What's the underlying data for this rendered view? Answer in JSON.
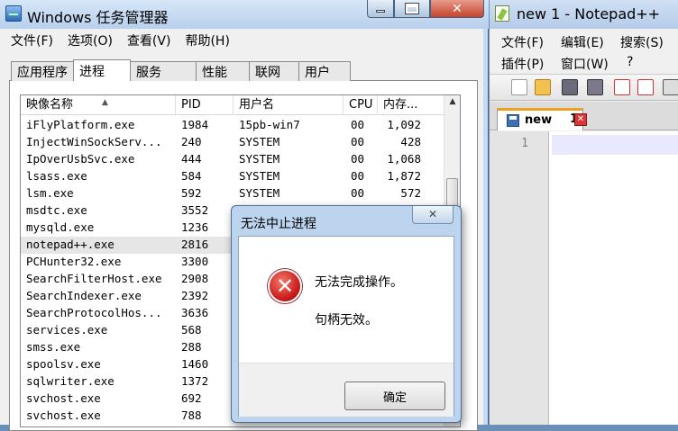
{
  "task_manager": {
    "title": "Windows 任务管理器",
    "menu": [
      "文件(F)",
      "选项(O)",
      "查看(V)",
      "帮助(H)"
    ],
    "tabs": [
      "应用程序",
      "进程",
      "服务",
      "性能",
      "联网",
      "用户"
    ],
    "active_tab": "进程",
    "columns": [
      "映像名称",
      "PID",
      "用户名",
      "CPU",
      "内存..."
    ],
    "processes": [
      {
        "name": "iFlyPlatform.exe",
        "pid": "1984",
        "user": "15pb-win7",
        "cpu": "00",
        "mem": "1,092"
      },
      {
        "name": "InjectWinSockServ...",
        "pid": "240",
        "user": "SYSTEM",
        "cpu": "00",
        "mem": "428"
      },
      {
        "name": "IpOverUsbSvc.exe",
        "pid": "444",
        "user": "SYSTEM",
        "cpu": "00",
        "mem": "1,068"
      },
      {
        "name": "lsass.exe",
        "pid": "584",
        "user": "SYSTEM",
        "cpu": "00",
        "mem": "1,872"
      },
      {
        "name": "lsm.exe",
        "pid": "592",
        "user": "SYSTEM",
        "cpu": "00",
        "mem": "572"
      },
      {
        "name": "msdtc.exe",
        "pid": "3552",
        "user": "",
        "cpu": "",
        "mem": ""
      },
      {
        "name": "mysqld.exe",
        "pid": "1236",
        "user": "",
        "cpu": "",
        "mem": ""
      },
      {
        "name": "notepad++.exe",
        "pid": "2816",
        "user": "",
        "cpu": "",
        "mem": "",
        "selected": true
      },
      {
        "name": "PCHunter32.exe",
        "pid": "3300",
        "user": "",
        "cpu": "",
        "mem": ""
      },
      {
        "name": "SearchFilterHost.exe",
        "pid": "2908",
        "user": "",
        "cpu": "",
        "mem": ""
      },
      {
        "name": "SearchIndexer.exe",
        "pid": "2392",
        "user": "",
        "cpu": "",
        "mem": ""
      },
      {
        "name": "SearchProtocolHos...",
        "pid": "3636",
        "user": "",
        "cpu": "",
        "mem": ""
      },
      {
        "name": "services.exe",
        "pid": "568",
        "user": "",
        "cpu": "",
        "mem": ""
      },
      {
        "name": "smss.exe",
        "pid": "288",
        "user": "",
        "cpu": "",
        "mem": ""
      },
      {
        "name": "spoolsv.exe",
        "pid": "1460",
        "user": "",
        "cpu": "",
        "mem": ""
      },
      {
        "name": "sqlwriter.exe",
        "pid": "1372",
        "user": "",
        "cpu": "",
        "mem": ""
      },
      {
        "name": "svchost.exe",
        "pid": "692",
        "user": "",
        "cpu": "",
        "mem": ""
      },
      {
        "name": "svchost.exe",
        "pid": "788",
        "user": "",
        "cpu": "",
        "mem": ""
      }
    ]
  },
  "notepad": {
    "title": "new 1 - Notepad++",
    "menu_row1": [
      "文件(F)",
      "编辑(E)",
      "搜索(S)"
    ],
    "menu_row2": [
      "插件(P)",
      "窗口(W)",
      "?"
    ],
    "tab_label": "new",
    "tab_number": "1",
    "line_number": "1"
  },
  "dialog": {
    "title": "无法中止进程",
    "message1": "无法完成操作。",
    "message2": "句柄无效。",
    "ok_label": "确定"
  }
}
